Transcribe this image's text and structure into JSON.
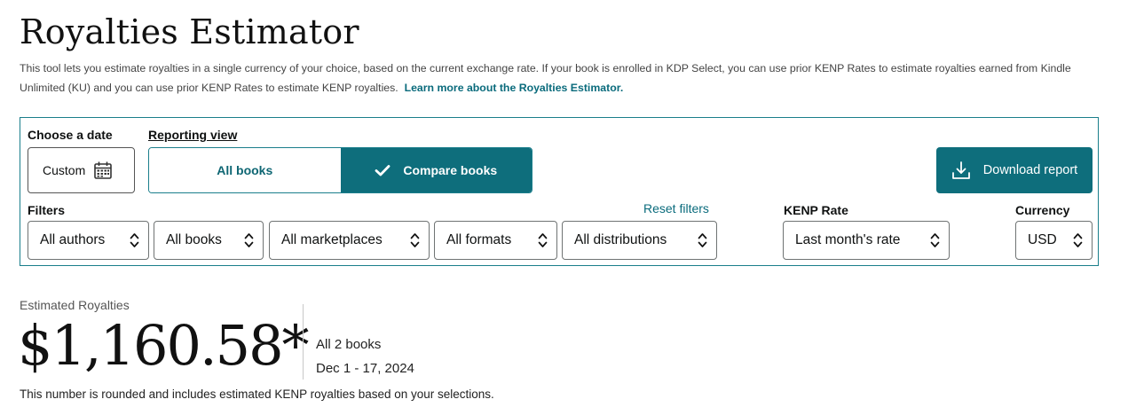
{
  "header": {
    "title": "Royalties Estimator",
    "intro_text": "This tool lets you estimate royalties in a single currency of your choice, based on the current exchange rate. If your book is enrolled in KDP Select, you can use prior KENP Rates to estimate royalties earned from Kindle Unlimited (KU) and you can use prior KENP Rates to estimate KENP royalties.",
    "learn_more_link": "Learn more about the Royalties Estimator."
  },
  "controls": {
    "date_label": "Choose a date",
    "date_value": "Custom",
    "reporting_label": "Reporting view",
    "view_all_books": "All books",
    "view_compare_books": "Compare books",
    "selected_view": "Compare books",
    "download_label": "Download report"
  },
  "filters": {
    "label": "Filters",
    "reset_label": "Reset filters",
    "authors": "All authors",
    "books": "All books",
    "marketplaces": "All marketplaces",
    "formats": "All formats",
    "distributions": "All distributions",
    "kenp_label": "KENP Rate",
    "kenp_value": "Last month's rate",
    "currency_label": "Currency",
    "currency_value": "USD"
  },
  "summary": {
    "label": "Estimated Royalties",
    "amount": "$1,160.58*",
    "books": "All 2 books",
    "date_range": "Dec 1 - 17, 2024",
    "note": "This number is rounded and includes estimated KENP royalties based on your selections."
  },
  "colors": {
    "accent": "#0e6e7c",
    "link": "#0a6b7c"
  },
  "icons": {
    "date": "calendar-icon",
    "selected": "checkmark-icon",
    "download": "download-icon",
    "select": "chevron-up-down-icon"
  }
}
